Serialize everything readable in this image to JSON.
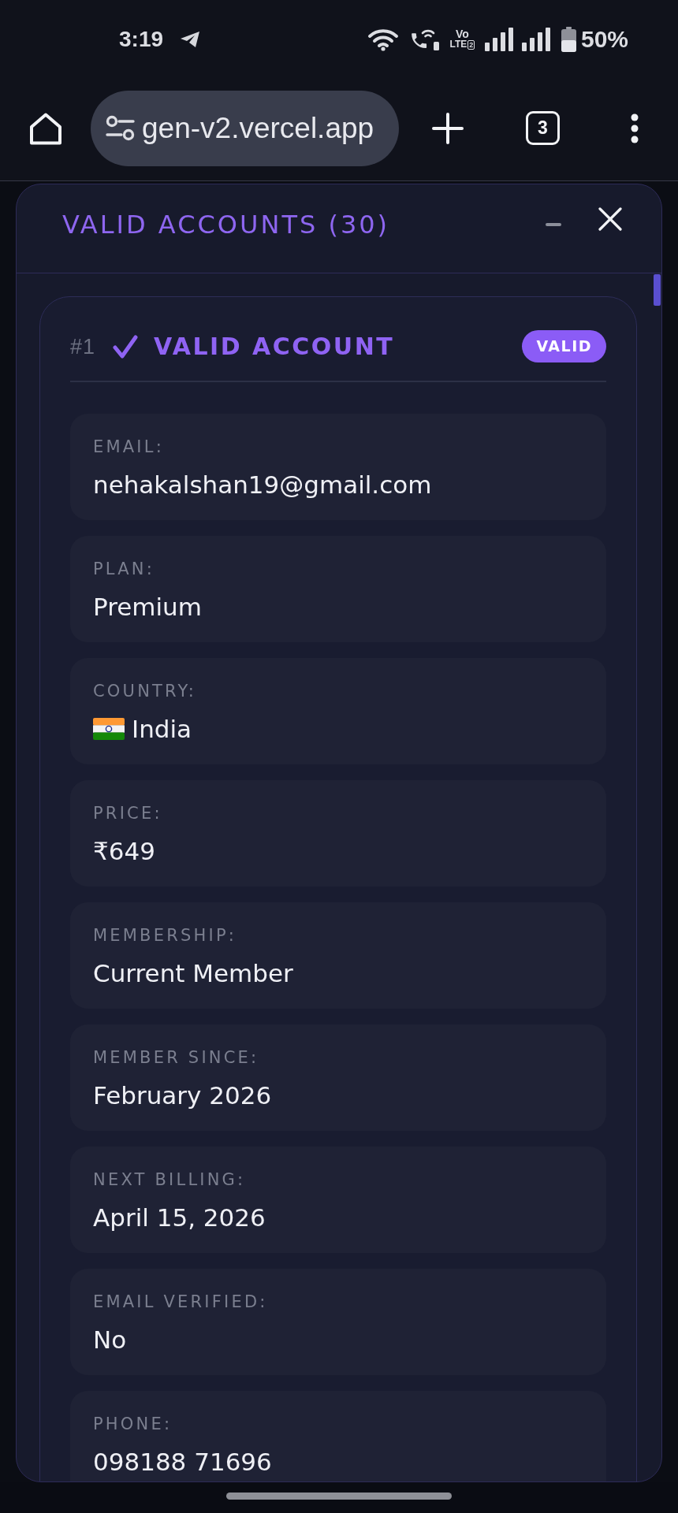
{
  "status_bar": {
    "time": "3:19",
    "volte": {
      "top": "Vo",
      "bottom": "LTE",
      "sim": "2"
    },
    "battery": "50%"
  },
  "browser": {
    "url": "gen-v2.vercel.app",
    "tab_count": "3"
  },
  "panel": {
    "title": "VALID ACCOUNTS (30)"
  },
  "accounts": [
    {
      "number": "#1",
      "title": "VALID ACCOUNT",
      "badge": "VALID",
      "fields": [
        {
          "kind": "text",
          "label": "EMAIL:",
          "value": "nehakalshan19@gmail.com"
        },
        {
          "kind": "text",
          "label": "PLAN:",
          "value": "Premium"
        },
        {
          "kind": "country",
          "label": "COUNTRY:",
          "value": "India"
        },
        {
          "kind": "text",
          "label": "PRICE:",
          "value": "₹649"
        },
        {
          "kind": "text",
          "label": "MEMBERSHIP:",
          "value": "Current Member"
        },
        {
          "kind": "text",
          "label": "MEMBER SINCE:",
          "value": "February 2026"
        },
        {
          "kind": "text",
          "label": "NEXT BILLING:",
          "value": "April 15, 2026"
        },
        {
          "kind": "text",
          "label": "EMAIL VERIFIED:",
          "value": "No"
        },
        {
          "kind": "text",
          "label": "PHONE:",
          "value": "098188 71696"
        }
      ]
    }
  ]
}
